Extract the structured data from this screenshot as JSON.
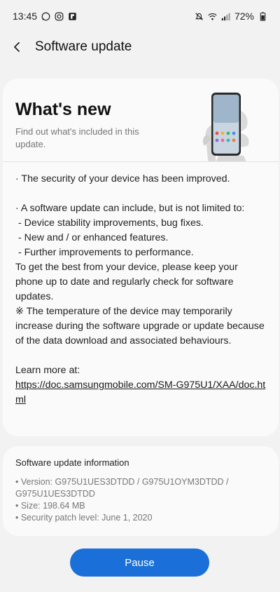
{
  "status_bar": {
    "time": "13:45",
    "battery": "72%",
    "left_icons": [
      "whatsapp-icon",
      "instagram-icon",
      "flipboard-icon"
    ],
    "right_icons": [
      "mute-icon",
      "wifi-icon",
      "signal-icon",
      "battery-icon"
    ]
  },
  "header": {
    "title": "Software update"
  },
  "whats_new": {
    "title": "What's new",
    "subtitle": "Find out what's included in this update."
  },
  "body": {
    "lines": [
      "· The security of your device has been improved.",
      "",
      "· A software update can include, but is not limited to:",
      " - Device stability improvements, bug fixes.",
      " - New and / or enhanced features.",
      " - Further improvements to performance.",
      "To get the best from your device, please keep your phone up to date and regularly check for software updates.",
      "※ The temperature of the device may temporarily increase during the software upgrade or update because of the data download and associated behaviours.",
      "",
      "Learn more at:"
    ],
    "link": "https://doc.samsungmobile.com/SM-G975U1/XAA/doc.html"
  },
  "info": {
    "title": "Software update information",
    "version": "• Version: G975U1UES3DTDD / G975U1OYM3DTDD / G975U1UES3DTDD",
    "size": "• Size: 198.64 MB",
    "patch": "• Security patch level: June 1, 2020"
  },
  "actions": {
    "pause_label": "Pause"
  },
  "colors": {
    "accent": "#1a6fd8",
    "background": "#f2f2f2",
    "card": "#fafafa"
  }
}
